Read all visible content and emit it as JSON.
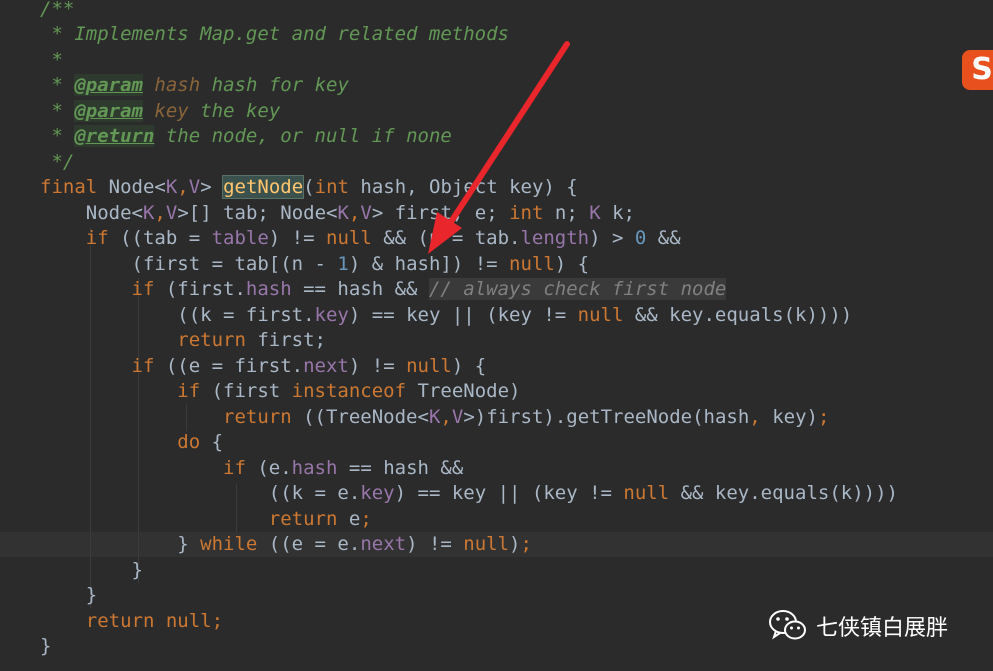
{
  "code": {
    "l0": "/**",
    "l1": " * Implements Map.get and related methods",
    "l2": " *",
    "l3_a": " * ",
    "l3_tag": "@param",
    "l3_b": " ",
    "l3_name": "hash",
    "l3_c": " hash for key",
    "l4_a": " * ",
    "l4_tag": "@param",
    "l4_b": " ",
    "l4_name": "key",
    "l4_c": " the key",
    "l5_a": " * ",
    "l5_tag": "@return",
    "l5_c": " the node, or null if none",
    "l6": " */",
    "l7": {
      "final": "final",
      "p1": " Node<",
      "K": "K",
      "comma": ",",
      "V": "V",
      "p2": "> ",
      "fn": "getNode",
      "p3": "(",
      "int": "int",
      "p4": " hash, Object key) {"
    },
    "l8": {
      "p1": "    Node<",
      "K": "K",
      "comma": ",",
      "V": "V",
      "p2": ">[] tab; Node<",
      "K2": "K",
      "comma2": ",",
      "V2": "V",
      "p3": "> first, e; ",
      "int": "int",
      "p4": " n; ",
      "K3": "K",
      "p5": " k;"
    },
    "l9": {
      "if": "    if",
      "p1": " ((tab = ",
      "table": "table",
      "p2": ") != ",
      "null": "null",
      "p3": " && (n = tab.",
      "length": "length",
      "p4": ") > ",
      "zero": "0",
      "p5": " &&"
    },
    "l10": {
      "p1": "        (first = tab[(n - ",
      "one": "1",
      "p2": ") & hash]) != ",
      "null": "null",
      "p3": ") {"
    },
    "l11": {
      "if": "        if",
      "p1": " (first.",
      "hash": "hash",
      "p2": " == hash && ",
      "comment": "// always check first node"
    },
    "l12": {
      "p1": "            ((k = first.",
      "key": "key",
      "p2": ") == key || (key != ",
      "null": "null",
      "p3": " && key.equals(k))))"
    },
    "l13": {
      "ret": "            return",
      "p1": " first;"
    },
    "l14": {
      "if": "        if",
      "p1": " ((e = first.",
      "next": "next",
      "p2": ") != ",
      "null": "null",
      "p3": ") {"
    },
    "l15": {
      "if": "            if",
      "p1": " (first ",
      "inst": "instanceof",
      "p2": " TreeNode)"
    },
    "l16": {
      "ret": "                return",
      "p1": " ((TreeNode<",
      "K": "K",
      "comma": ",",
      "V": "V",
      "p2": ">)first).getTreeNode(hash",
      "comma2": ",",
      "p3": " key)",
      "semi": ";"
    },
    "l17": {
      "do": "            do",
      "p1": " {"
    },
    "l18": {
      "if": "                if",
      "p1": " (e.",
      "hash": "hash",
      "p2": " == hash &&"
    },
    "l19": {
      "p1": "                    ((k = e.",
      "key": "key",
      "p2": ") == key || (key != ",
      "null": "null",
      "p3": " && key.equals(k))))"
    },
    "l20": {
      "ret": "                    return",
      "p1": " e",
      "semi": ";"
    },
    "l21": {
      "p1": "            } ",
      "while": "while",
      "p2": " ((e = e.",
      "next": "next",
      "p3": ") != ",
      "null": "null",
      "p4": ")",
      "semi": ";"
    },
    "l22": "        }",
    "l23": "    }",
    "l24": {
      "ret": "    return",
      "null": " null",
      "semi": ";"
    },
    "l25": "}"
  },
  "watermark": {
    "text": "七侠镇白展胖",
    "icon": "wechat-icon"
  },
  "brand_badge": {
    "text": "S",
    "icon": "sogou-ime-icon"
  },
  "annotation": {
    "icon": "red-arrow-icon",
    "color": "#e8262b"
  },
  "colors": {
    "background": "#2b2b2b",
    "keyword": "#cc7832",
    "doc_comment": "#629755",
    "field": "#9876aa",
    "number": "#6897bb",
    "method_highlight": "#ffc66d"
  }
}
